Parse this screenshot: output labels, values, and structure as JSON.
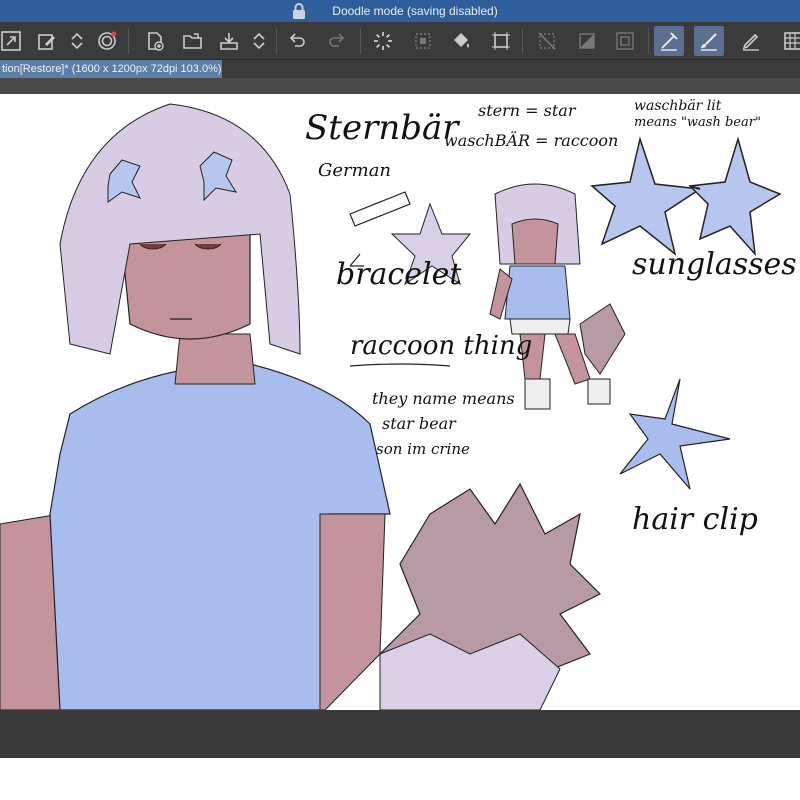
{
  "titlebar": {
    "title": "Doodle mode (saving disabled)",
    "icon": "lock-icon",
    "background": "#2f5f9a"
  },
  "toolbar": {
    "background": "#3b3b3b",
    "active_color": "#5a6f92",
    "icons": [
      "resize-icon",
      "eyedropper-edit-icon",
      "expand-collapse-icon",
      "spiral-icon",
      "new-file-icon",
      "open-folder-icon",
      "save-tray-icon",
      "chevron-updown-icon",
      "undo-icon",
      "redo-icon",
      "loading-spinner-icon",
      "selection-dots-icon",
      "fill-bucket-icon",
      "transform-icon",
      "clear-selection-icon",
      "gradient-icon",
      "crop-frame-icon",
      "pen-tool-icon",
      "brush-tool-icon",
      "pencil-tool-icon",
      "grid-icon"
    ]
  },
  "document": {
    "tab_label": "tion[Restore]* (1600 x 1200px 72dpi 103.0%)",
    "tab_color": "#5d7ea6"
  },
  "notes": {
    "name": "Sternbär",
    "german": "German",
    "stern": "stern = star",
    "waschbar": "waschBÄR = raccoon",
    "wasch_lit": "waschbär lit",
    "wash_means": "means \"wash bear\"",
    "bracelet": "bracelet",
    "raccoon_thing": "raccoon thing",
    "name_means_1": "they name means",
    "name_means_2": "star bear",
    "name_means_3": "son im crine",
    "sunglasses": "sunglasses",
    "hair_clip": "hair clip"
  },
  "colors": {
    "shirt": "#a9bcee",
    "skin": "#c4949c",
    "hair": "#d8cce4",
    "tail_dark": "#b89aa6",
    "tail_light": "#d9cfe6",
    "star_blue": "#b6c6ef"
  }
}
